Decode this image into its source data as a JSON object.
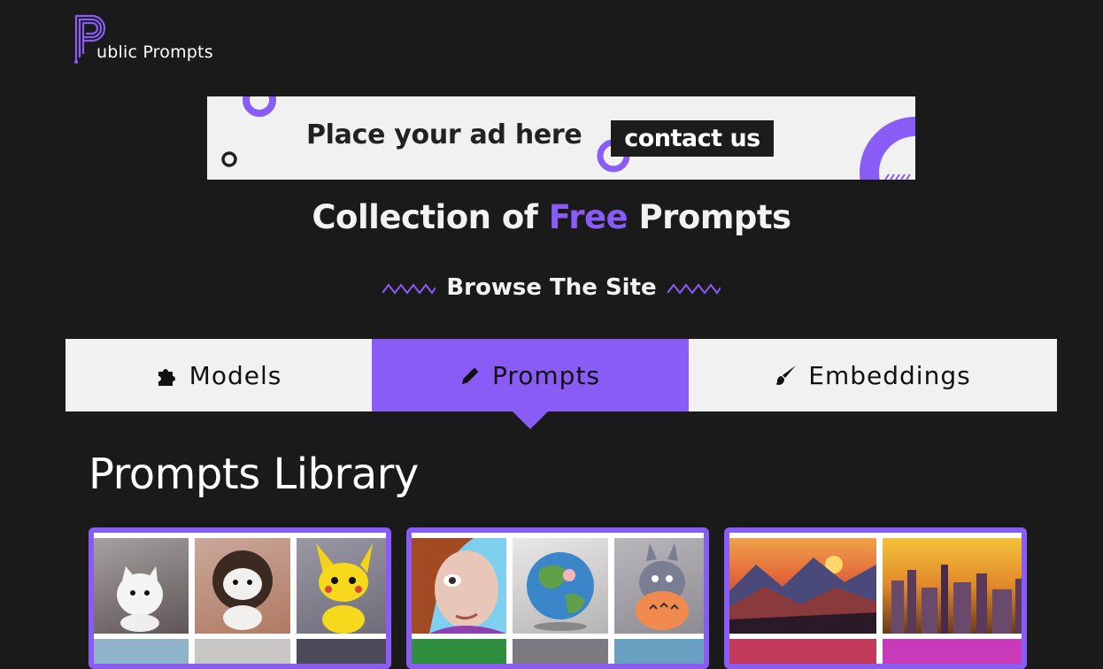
{
  "brand": {
    "name": "ublic Prompts",
    "accent": "#8a5cf6"
  },
  "ad": {
    "text": "Place your ad here",
    "button": "contact us"
  },
  "hero": {
    "prefix": "Collection of",
    "accent_word": "Free",
    "suffix": "Prompts"
  },
  "browse": {
    "label": "Browse The Site"
  },
  "tabs": [
    {
      "label": "Models",
      "icon": "puzzle-icon"
    },
    {
      "label": "Prompts",
      "icon": "pencil-icon",
      "active": true
    },
    {
      "label": "Embeddings",
      "icon": "brush-icon"
    }
  ],
  "library": {
    "title": "Prompts Library"
  }
}
